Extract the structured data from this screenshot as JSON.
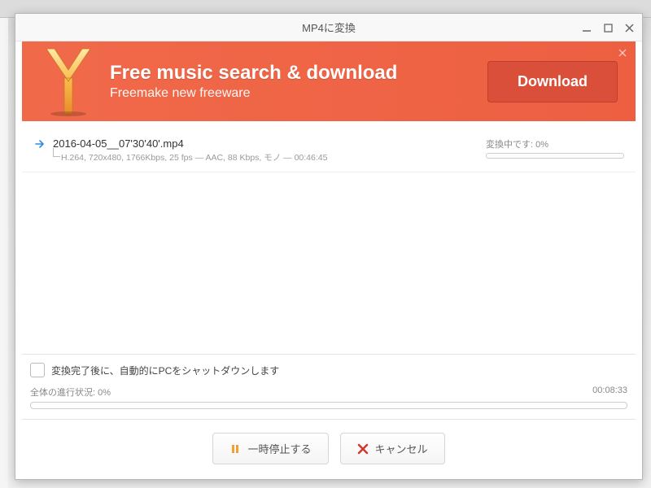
{
  "window": {
    "title": "MP4に変換"
  },
  "banner": {
    "title": "Free music search & download",
    "subtitle": "Freemake new freeware",
    "download_label": "Download"
  },
  "file": {
    "name": "2016-04-05__07'30'40'.mp4",
    "desc": "H.264, 720x480, 1766Kbps, 25 fps — AAC, 88 Kbps, モノ — 00:46:45",
    "status_prefix": "変換中です:",
    "status_percent": "0%"
  },
  "shutdown": {
    "label": "変換完了後に、自動的にPCをシャットダウンします"
  },
  "overall": {
    "label_prefix": "全体の進行状況:",
    "percent": "0%",
    "elapsed": "00:08:33"
  },
  "buttons": {
    "pause": "一時停止する",
    "cancel": "キャンセル"
  }
}
